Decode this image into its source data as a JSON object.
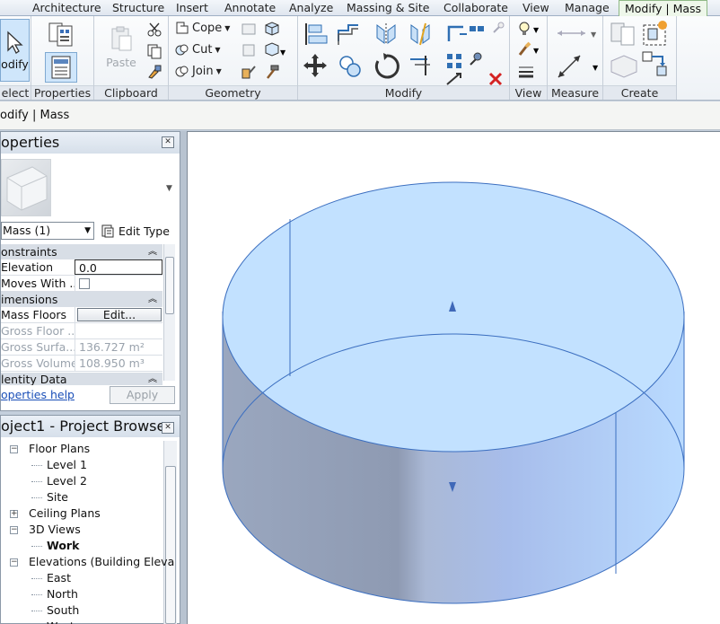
{
  "tabs": [
    {
      "label": "Architecture",
      "active": false
    },
    {
      "label": "Structure",
      "active": false
    },
    {
      "label": "Insert",
      "active": false
    },
    {
      "label": "Annotate",
      "active": false
    },
    {
      "label": "Analyze",
      "active": false
    },
    {
      "label": "Massing & Site",
      "active": false
    },
    {
      "label": "Collaborate",
      "active": false
    },
    {
      "label": "View",
      "active": false
    },
    {
      "label": "Manage",
      "active": false
    },
    {
      "label": "Modify | Mass",
      "active": true
    }
  ],
  "ribbon": {
    "select": {
      "modify_label": "odify",
      "panel": "elect"
    },
    "properties": {
      "panel": "Properties"
    },
    "clipboard": {
      "paste_label": "Paste",
      "panel": "Clipboard"
    },
    "geometry": {
      "cope": "Cope",
      "cut": "Cut",
      "join": "Join",
      "panel": "Geometry"
    },
    "modify": {
      "panel": "Modify"
    },
    "view": {
      "panel": "View"
    },
    "measure": {
      "panel": "Measure"
    },
    "create": {
      "panel": "Create"
    }
  },
  "context_bar": {
    "label": "odify | Mass"
  },
  "properties": {
    "title": "operties",
    "type_selector": "Mass (1)",
    "edit_type": "Edit Type",
    "categories": [
      "onstraints",
      "imensions",
      "lentity Data"
    ],
    "rows": [
      {
        "name": "Elevation",
        "value": "0.0"
      },
      {
        "name": "Moves With ...",
        "value": ""
      },
      {
        "name": "Mass Floors",
        "value": "Edit..."
      },
      {
        "name": "Gross Floor ...",
        "value": ""
      },
      {
        "name": "Gross Surfa...",
        "value": "136.727 m²"
      },
      {
        "name": "Gross Volume",
        "value": "108.950 m³"
      }
    ],
    "help_link": "operties help",
    "apply_button": "Apply"
  },
  "project_browser": {
    "title": "oject1 - Project Browser",
    "items": [
      {
        "label": "Floor Plans",
        "level": 1,
        "expand": "-"
      },
      {
        "label": "Level 1",
        "level": 2
      },
      {
        "label": "Level 2",
        "level": 2
      },
      {
        "label": "Site",
        "level": 2
      },
      {
        "label": "Ceiling Plans",
        "level": 1,
        "expand": "+"
      },
      {
        "label": "3D Views",
        "level": 1,
        "expand": "-"
      },
      {
        "label": "Work",
        "level": 2,
        "bold": true
      },
      {
        "label": "Elevations (Building Eleva",
        "level": 1,
        "expand": "-"
      },
      {
        "label": "East",
        "level": 2
      },
      {
        "label": "North",
        "level": 2
      },
      {
        "label": "South",
        "level": 2
      },
      {
        "label": "West",
        "level": 2
      }
    ]
  },
  "colors": {
    "active_tab_bg": "#eef7ea",
    "mass_top": "#c4e3ff",
    "mass_edge": "#3c6fc0",
    "mass_side_dark": "#8f9bb3",
    "mass_side_light": "#b5d6ff"
  }
}
